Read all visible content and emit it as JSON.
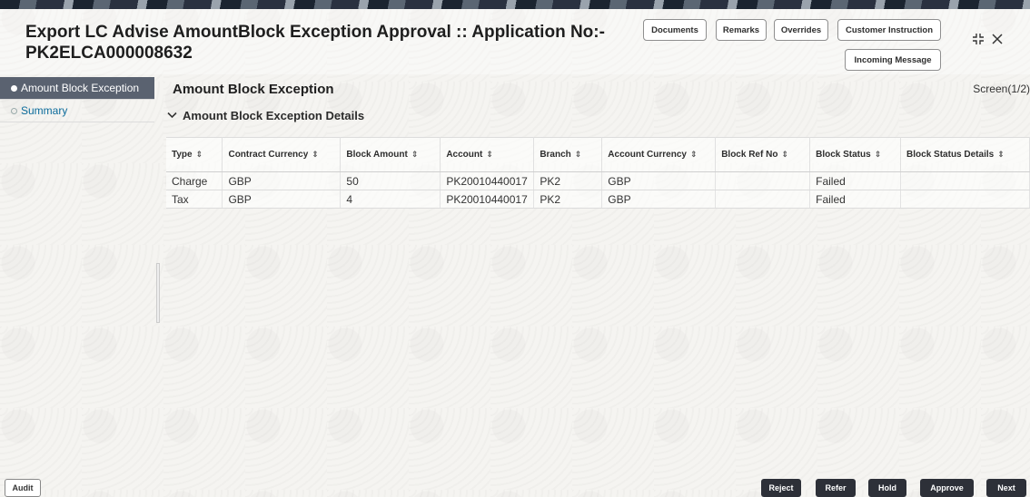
{
  "header": {
    "title_line1": "Export LC Advise AmountBlock Exception Approval :: Application No:-",
    "title_line2": "PK2ELCA000008632",
    "buttons": {
      "documents": "Documents",
      "remarks": "Remarks",
      "overrides": "Overrides",
      "customer_instruction": "Customer Instruction",
      "incoming_message": "Incoming Message"
    },
    "icons": {
      "collapse": "collapse-icon",
      "close": "close-icon"
    }
  },
  "sidebar": {
    "items": [
      {
        "label": "Amount Block Exception",
        "active": true
      },
      {
        "label": "Summary",
        "active": false
      }
    ]
  },
  "main": {
    "section_title": "Amount Block Exception",
    "screen_label": "Screen(1/2)",
    "sub_title": "Amount Block Exception Details",
    "table": {
      "headers": [
        "Type",
        "Contract Currency",
        "Block Amount",
        "Account",
        "Branch",
        "Account Currency",
        "Block Ref No",
        "Block Status",
        "Block Status Details"
      ],
      "rows": [
        [
          "Charge",
          "GBP",
          "50",
          "PK20010440017",
          "PK2",
          "GBP",
          "",
          "Failed",
          ""
        ],
        [
          "Tax",
          "GBP",
          "4",
          "PK20010440017",
          "PK2",
          "GBP",
          "",
          "Failed",
          ""
        ]
      ]
    }
  },
  "footer": {
    "audit": "Audit",
    "reject": "Reject",
    "refer": "Refer",
    "hold": "Hold",
    "approve": "Approve",
    "next": "Next"
  },
  "colors": {
    "active_sidebar": "#5a6270",
    "link": "#0b6b9b",
    "dark_button": "#2d3038"
  }
}
